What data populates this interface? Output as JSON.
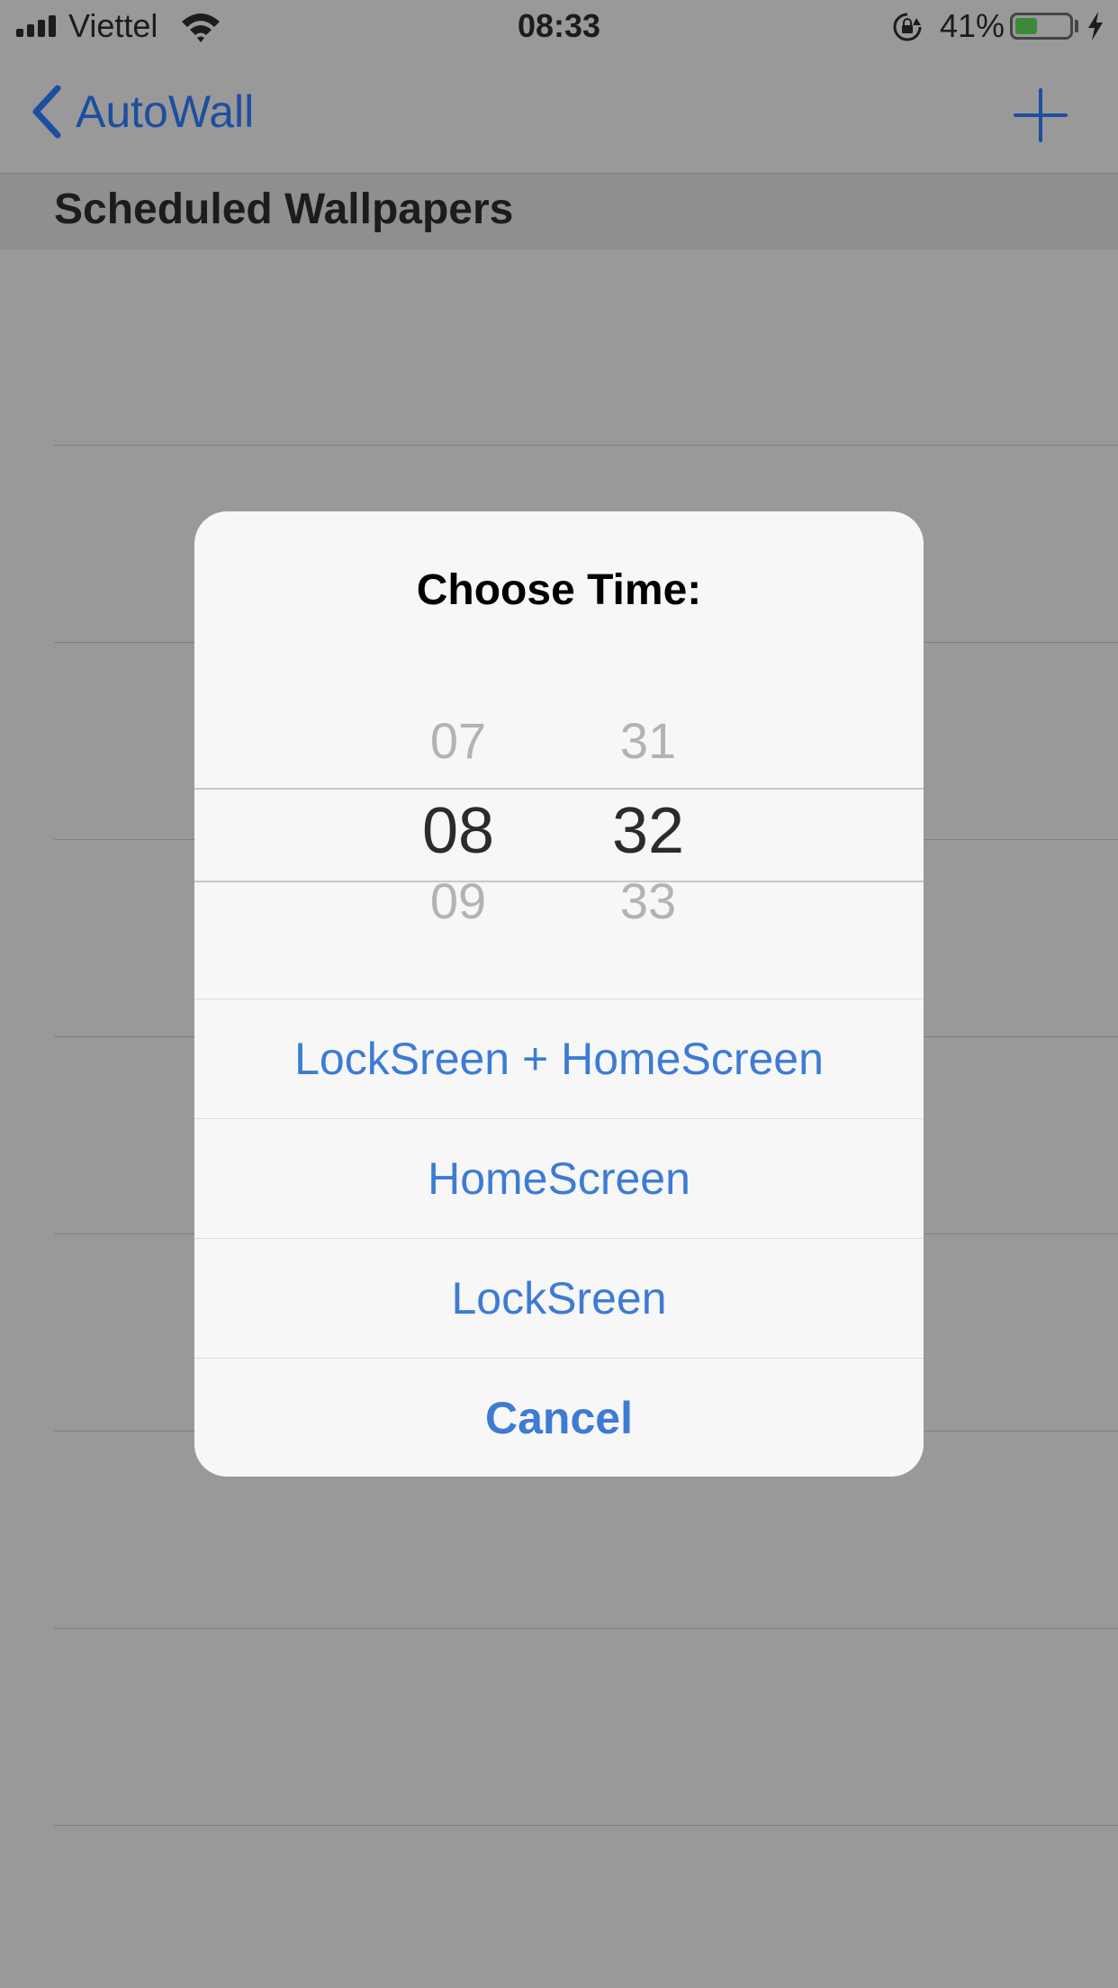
{
  "status_bar": {
    "carrier": "Viettel",
    "time": "08:33",
    "battery_percent": "41%",
    "battery_level": 0.41
  },
  "nav": {
    "back_label": "AutoWall"
  },
  "section": {
    "title": "Scheduled Wallpapers"
  },
  "modal": {
    "title": "Choose Time:",
    "picker": {
      "hours": [
        "07",
        "08",
        "09"
      ],
      "minutes": [
        "31",
        "32",
        "33"
      ],
      "selected_hour": "08",
      "selected_minute": "32"
    },
    "actions": [
      {
        "label": "LockSreen + HomeScreen"
      },
      {
        "label": "HomeScreen"
      },
      {
        "label": "LockSreen"
      },
      {
        "label": "Cancel"
      }
    ]
  },
  "colors": {
    "accent": "#3d7bd4",
    "nav_tint": "#1e4ea0",
    "dim_overlay": "#999999"
  }
}
